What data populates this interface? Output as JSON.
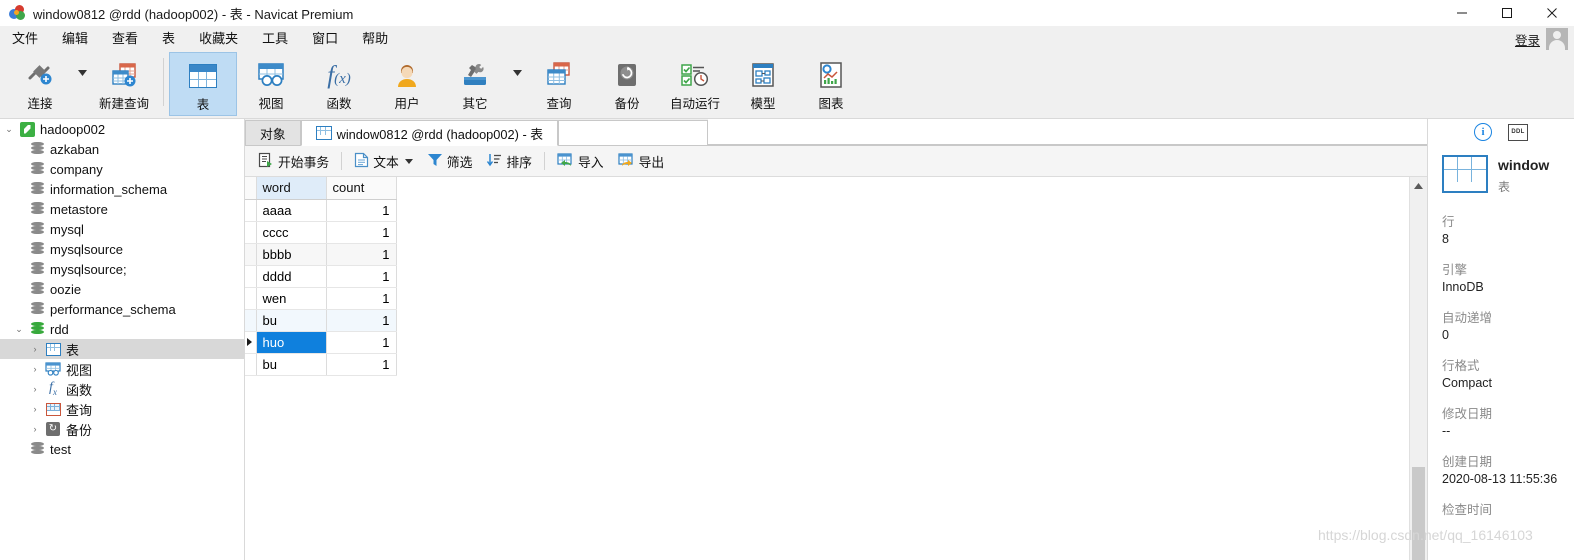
{
  "window": {
    "title": "window0812 @rdd (hadoop002) - 表 - Navicat Premium",
    "minimize": "—",
    "maximize": "□",
    "close": "✕"
  },
  "menubar": {
    "items": [
      "文件",
      "编辑",
      "查看",
      "表",
      "收藏夹",
      "工具",
      "窗口",
      "帮助"
    ],
    "login_label": "登录"
  },
  "toolbar": {
    "items": [
      {
        "label": "连接",
        "icon": "connection-icon",
        "caret": true
      },
      {
        "label": "新建查询",
        "icon": "new-query-icon",
        "caret": false
      },
      {
        "label": "表",
        "icon": "table-icon",
        "selected": true
      },
      {
        "label": "视图",
        "icon": "view-icon"
      },
      {
        "label": "函数",
        "icon": "function-icon"
      },
      {
        "label": "用户",
        "icon": "user-icon"
      },
      {
        "label": "其它",
        "icon": "other-tools-icon",
        "caret": true
      },
      {
        "label": "查询",
        "icon": "query-icon"
      },
      {
        "label": "备份",
        "icon": "backup-icon"
      },
      {
        "label": "自动运行",
        "icon": "automation-icon"
      },
      {
        "label": "模型",
        "icon": "model-icon"
      },
      {
        "label": "图表",
        "icon": "chart-icon"
      }
    ]
  },
  "sidebar": {
    "items": [
      {
        "label": "hadoop002",
        "icon": "server-icon",
        "level": 0,
        "expander": "expanded"
      },
      {
        "label": "azkaban",
        "icon": "database-icon",
        "level": 1
      },
      {
        "label": "company",
        "icon": "database-icon",
        "level": 1
      },
      {
        "label": "information_schema",
        "icon": "database-icon",
        "level": 1
      },
      {
        "label": "metastore",
        "icon": "database-icon",
        "level": 1
      },
      {
        "label": "mysql",
        "icon": "database-icon",
        "level": 1
      },
      {
        "label": "mysqlsource",
        "icon": "database-icon",
        "level": 1
      },
      {
        "label": "mysqlsource;",
        "icon": "database-icon",
        "level": 1
      },
      {
        "label": "oozie",
        "icon": "database-icon",
        "level": 1
      },
      {
        "label": "performance_schema",
        "icon": "database-icon",
        "level": 1
      },
      {
        "label": "rdd",
        "icon": "database-active-icon",
        "level": 1,
        "expander": "expanded"
      },
      {
        "label": "表",
        "icon": "tables-folder-icon",
        "level": 2,
        "expander": "collapsed",
        "selected": true
      },
      {
        "label": "视图",
        "icon": "views-folder-icon",
        "level": 2,
        "expander": "collapsed"
      },
      {
        "label": "函数",
        "icon": "functions-folder-icon",
        "level": 2,
        "expander": "collapsed"
      },
      {
        "label": "查询",
        "icon": "queries-folder-icon",
        "level": 2,
        "expander": "collapsed"
      },
      {
        "label": "备份",
        "icon": "backups-folder-icon",
        "level": 2,
        "expander": "collapsed"
      },
      {
        "label": "test",
        "icon": "database-icon",
        "level": 1
      }
    ]
  },
  "tabs": {
    "objects_label": "对象",
    "active_label": "window0812 @rdd (hadoop002) - 表"
  },
  "gridbar": {
    "items": [
      {
        "label": "开始事务",
        "icon": "begin-transaction-icon"
      },
      {
        "label": "文本",
        "icon": "text-icon",
        "caret": true
      },
      {
        "label": "筛选",
        "icon": "filter-icon"
      },
      {
        "label": "排序",
        "icon": "sort-icon"
      },
      {
        "label": "导入",
        "icon": "import-icon"
      },
      {
        "label": "导出",
        "icon": "export-icon"
      }
    ]
  },
  "grid": {
    "columns": [
      "word",
      "count"
    ],
    "active_column": "word",
    "rows": [
      {
        "word": "aaaa",
        "count": "1"
      },
      {
        "word": "cccc",
        "count": "1"
      },
      {
        "word": "bbbb",
        "count": "1"
      },
      {
        "word": "dddd",
        "count": "1"
      },
      {
        "word": "wen",
        "count": "1"
      },
      {
        "word": "bu",
        "count": "1"
      },
      {
        "word": "huo",
        "count": "1"
      },
      {
        "word": "bu",
        "count": "1"
      }
    ],
    "selected_row_index": 6,
    "selected_column": "word"
  },
  "infopanel": {
    "tab_info_icon": "info-icon",
    "tab_ddl_label": "DDL",
    "object_name": "window",
    "object_type": "表",
    "fields": [
      {
        "key": "行",
        "value": "8"
      },
      {
        "key": "引擎",
        "value": "InnoDB"
      },
      {
        "key": "自动递增",
        "value": "0"
      },
      {
        "key": "行格式",
        "value": "Compact"
      },
      {
        "key": "修改日期",
        "value": "--"
      },
      {
        "key": "创建日期",
        "value": "2020-08-13 11:55:36"
      },
      {
        "key": "检查时间",
        "value": ""
      }
    ]
  },
  "watermark": "https://blog.csdn.net/qq_16146103",
  "colors": {
    "accent": "#0f80dd",
    "toolbar_selected": "#bfdcf4",
    "tree_selected": "#d8d8d8"
  }
}
